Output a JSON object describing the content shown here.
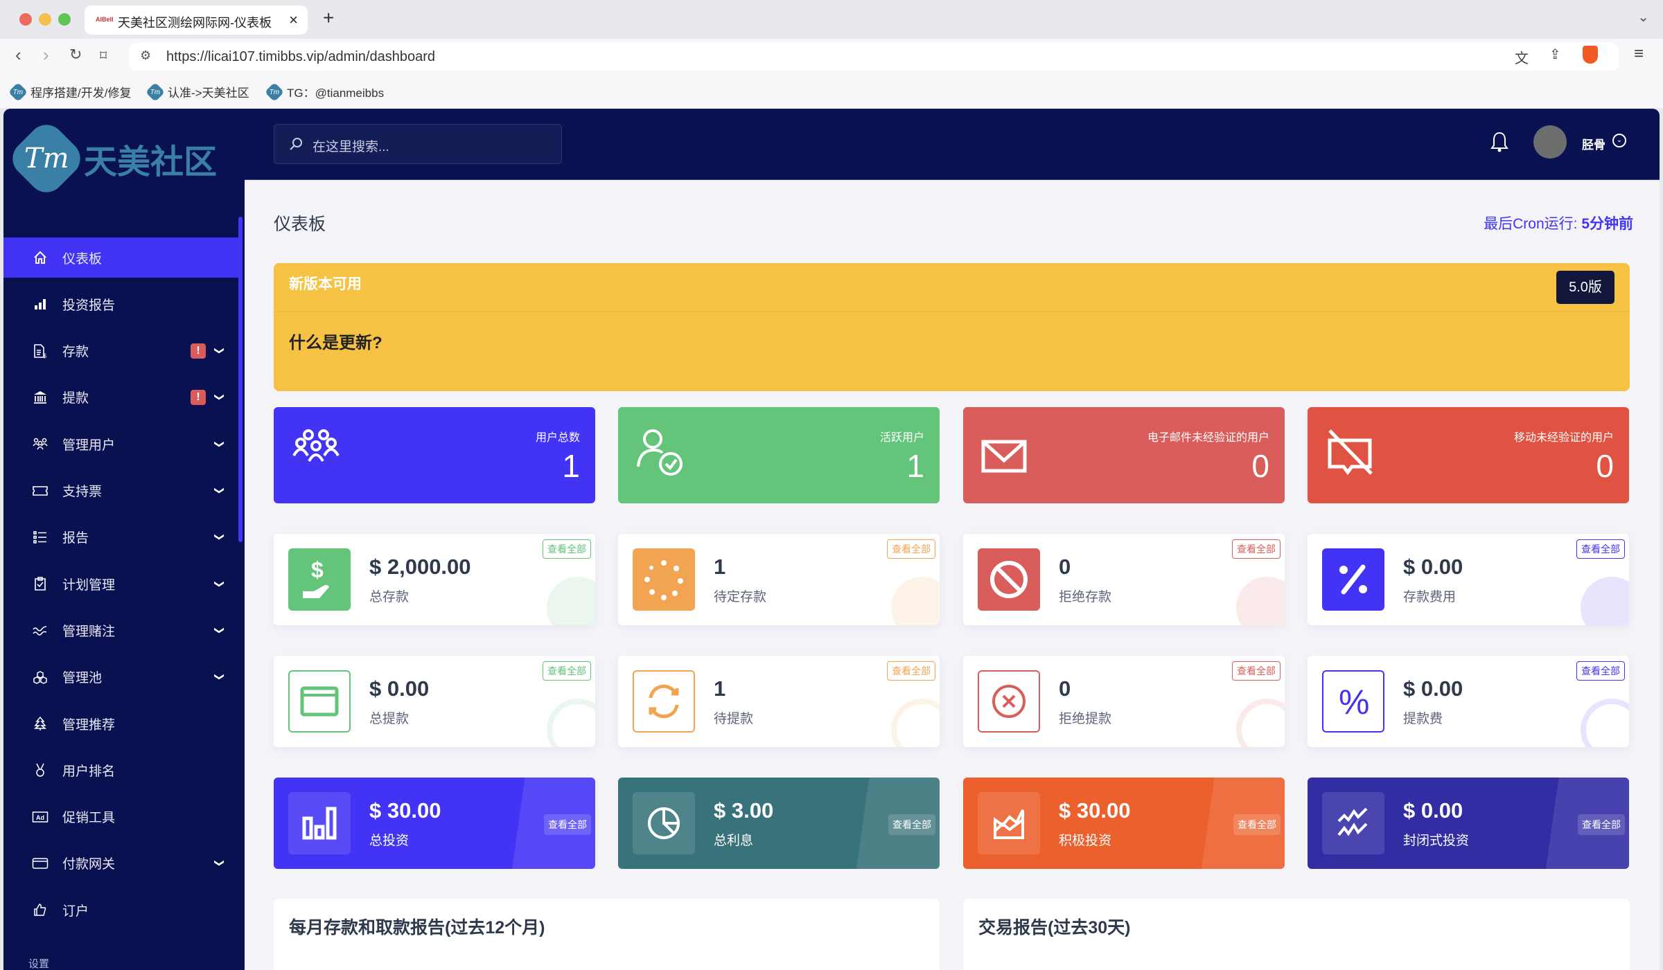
{
  "browser": {
    "tab_title": "天美社区测绘网际网-仪表板",
    "tab_favicon_text": "AIBell",
    "url": "https://licai107.timibbs.vip/admin/dashboard",
    "bookmarks": [
      "程序搭建/开发/修复",
      "认准->天美社区",
      "TG：@tianmeibbs"
    ]
  },
  "sidebar": {
    "logo_text": "天美社区",
    "logo_mark": "Tm",
    "items": [
      {
        "label": "仪表板",
        "icon": "home-icon",
        "active": true
      },
      {
        "label": "投资报告",
        "icon": "bar-chart-icon"
      },
      {
        "label": "存款",
        "icon": "invoice-dollar-icon",
        "alert": "!",
        "expandable": true
      },
      {
        "label": "提款",
        "icon": "bank-icon",
        "alert": "!",
        "expandable": true
      },
      {
        "label": "管理用户",
        "icon": "users-icon",
        "expandable": true
      },
      {
        "label": "支持票",
        "icon": "ticket-icon",
        "expandable": true
      },
      {
        "label": "报告",
        "icon": "list-icon",
        "expandable": true
      },
      {
        "label": "计划管理",
        "icon": "clipboard-check-icon",
        "expandable": true
      },
      {
        "label": "管理赌注",
        "icon": "wave-icon",
        "expandable": true
      },
      {
        "label": "管理池",
        "icon": "cubes-icon",
        "expandable": true
      },
      {
        "label": "管理推荐",
        "icon": "tree-icon"
      },
      {
        "label": "用户排名",
        "icon": "medal-icon"
      },
      {
        "label": "促销工具",
        "icon": "ad-icon"
      },
      {
        "label": "付款网关",
        "icon": "credit-card-icon",
        "expandable": true
      },
      {
        "label": "订户",
        "icon": "thumbs-up-icon"
      }
    ],
    "section_settings": "设置"
  },
  "header": {
    "search_placeholder": "在这里搜索...",
    "username": "胫骨"
  },
  "page": {
    "title": "仪表板",
    "cron_label": "最后Cron运行: ",
    "cron_value": "5分钟前"
  },
  "banner": {
    "title": "新版本可用",
    "question": "什么是更新?",
    "version": "5.0版"
  },
  "colors": {
    "primary": "#4334f5",
    "green": "#63c47a",
    "red": "#d95d5b",
    "orange_red": "#e05241",
    "orange": "#f3a453",
    "teal": "#38737b",
    "deep_orange": "#ec602d",
    "indigo": "#332da4",
    "navy": "#0a1150",
    "yellow": "#f5c244"
  },
  "stats_top": [
    {
      "label": "用户总数",
      "value": "1"
    },
    {
      "label": "活跃用户",
      "value": "1"
    },
    {
      "label": "电子邮件未经验证的用户",
      "value": "0"
    },
    {
      "label": "移动未经验证的用户",
      "value": "0"
    }
  ],
  "view_all": "查看全部",
  "stats_deposit": [
    {
      "value": "$ 2,000.00",
      "label": "总存款"
    },
    {
      "value": "1",
      "label": "待定存款"
    },
    {
      "value": "0",
      "label": "拒绝存款"
    },
    {
      "value": "$ 0.00",
      "label": "存款费用"
    }
  ],
  "stats_withdraw": [
    {
      "value": "$ 0.00",
      "label": "总提款"
    },
    {
      "value": "1",
      "label": "待提款"
    },
    {
      "value": "0",
      "label": "拒绝提款"
    },
    {
      "value": "$ 0.00",
      "label": "提款费"
    }
  ],
  "stats_invest": [
    {
      "value": "$ 30.00",
      "label": "总投资"
    },
    {
      "value": "$ 3.00",
      "label": "总利息"
    },
    {
      "value": "$ 30.00",
      "label": "积极投资"
    },
    {
      "value": "$ 0.00",
      "label": "封闭式投资"
    }
  ],
  "reports": [
    {
      "title": "每月存款和取款报告(过去12个月)"
    },
    {
      "title": "交易报告(过去30天)"
    }
  ]
}
